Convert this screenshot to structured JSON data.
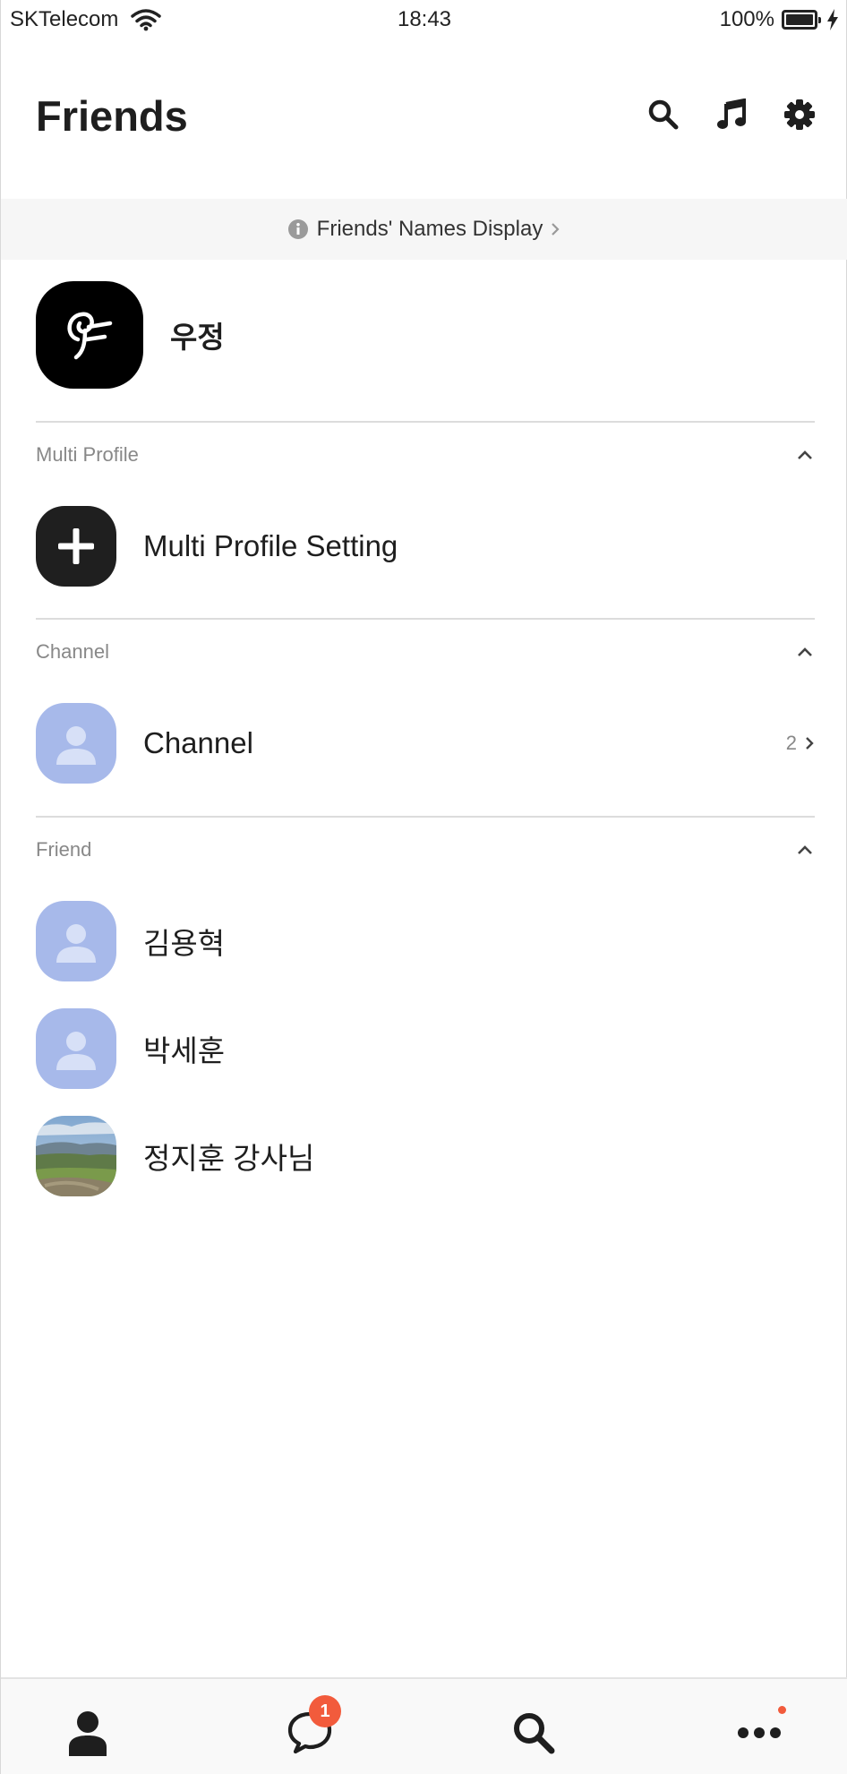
{
  "status_bar": {
    "carrier": "SKTelecom",
    "time": "18:43",
    "battery": "100%"
  },
  "header": {
    "title": "Friends",
    "icons": [
      "search-icon",
      "music-icon",
      "settings-icon"
    ]
  },
  "notice": {
    "text": "Friends' Names Display"
  },
  "my_profile": {
    "name": "우정"
  },
  "sections": {
    "multi_profile": {
      "label": "Multi Profile",
      "item_label": "Multi Profile Setting"
    },
    "channel": {
      "label": "Channel",
      "item_label": "Channel",
      "count": "2"
    },
    "friend": {
      "label": "Friend",
      "items": [
        {
          "name": "김용혁"
        },
        {
          "name": "박세훈"
        },
        {
          "name": "정지훈 강사님"
        }
      ]
    }
  },
  "bottom_nav": {
    "items": [
      "friends-tab",
      "chats-tab",
      "search-tab",
      "more-tab"
    ],
    "chat_badge": "1"
  },
  "colors": {
    "placeholder_avatar": "#a7b9ea",
    "badge": "#f25b3c",
    "text": "#1e1e1e"
  }
}
